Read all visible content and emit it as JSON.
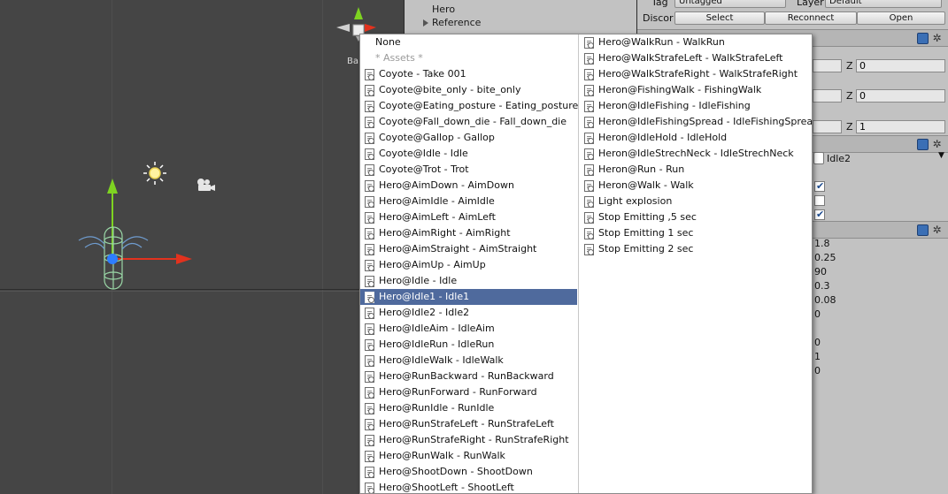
{
  "scene": {
    "gizmo_label": "Ba"
  },
  "hierarchy": {
    "items": [
      {
        "label": "Hero",
        "expandable": false
      },
      {
        "label": "Reference",
        "expandable": true
      }
    ]
  },
  "inspector": {
    "tag_label": "Tag",
    "tag_value": "Untagged",
    "layer_label": "Layer",
    "layer_value": "Default",
    "prefab_label": "Discor",
    "buttons": [
      "Select",
      "Reconnect",
      "Open"
    ],
    "transform": {
      "z_label": "Z",
      "position_z": "0",
      "rotation_z": "0",
      "scale_z": "1"
    },
    "animation_clip": "Idle2",
    "checkboxes": [
      true,
      false,
      true
    ],
    "values": [
      "1.8",
      "0.25",
      "90",
      "0.3",
      "0.08",
      "0",
      "0",
      "1",
      "0"
    ]
  },
  "popup": {
    "left_column": [
      {
        "label": "None",
        "icon": false,
        "style": "normal"
      },
      {
        "label": "* Assets *",
        "icon": false,
        "style": "muted"
      },
      {
        "label": "Coyote - Take 001",
        "icon": true
      },
      {
        "label": "Coyote@bite_only - bite_only",
        "icon": true
      },
      {
        "label": "Coyote@Eating_posture - Eating_posture",
        "icon": true
      },
      {
        "label": "Coyote@Fall_down_die - Fall_down_die",
        "icon": true
      },
      {
        "label": "Coyote@Gallop - Gallop",
        "icon": true
      },
      {
        "label": "Coyote@Idle - Idle",
        "icon": true
      },
      {
        "label": "Coyote@Trot - Trot",
        "icon": true
      },
      {
        "label": "Hero@AimDown - AimDown",
        "icon": true
      },
      {
        "label": "Hero@AimIdle - AimIdle",
        "icon": true
      },
      {
        "label": "Hero@AimLeft - AimLeft",
        "icon": true
      },
      {
        "label": "Hero@AimRight - AimRight",
        "icon": true
      },
      {
        "label": "Hero@AimStraight - AimStraight",
        "icon": true
      },
      {
        "label": "Hero@AimUp - AimUp",
        "icon": true
      },
      {
        "label": "Hero@Idle - Idle",
        "icon": true
      },
      {
        "label": "Hero@Idle1 - Idle1",
        "icon": true,
        "style": "selected"
      },
      {
        "label": "Hero@Idle2 - Idle2",
        "icon": true
      },
      {
        "label": "Hero@IdleAim - IdleAim",
        "icon": true
      },
      {
        "label": "Hero@IdleRun - IdleRun",
        "icon": true
      },
      {
        "label": "Hero@IdleWalk - IdleWalk",
        "icon": true
      },
      {
        "label": "Hero@RunBackward - RunBackward",
        "icon": true
      },
      {
        "label": "Hero@RunForward - RunForward",
        "icon": true
      },
      {
        "label": "Hero@RunIdle - RunIdle",
        "icon": true
      },
      {
        "label": "Hero@RunStrafeLeft - RunStrafeLeft",
        "icon": true
      },
      {
        "label": "Hero@RunStrafeRight - RunStrafeRight",
        "icon": true
      },
      {
        "label": "Hero@RunWalk - RunWalk",
        "icon": true
      },
      {
        "label": "Hero@ShootDown - ShootDown",
        "icon": true
      },
      {
        "label": "Hero@ShootLeft - ShootLeft",
        "icon": true
      }
    ],
    "right_column": [
      {
        "label": "Hero@WalkRun - WalkRun",
        "icon": true
      },
      {
        "label": "Hero@WalkStrafeLeft - WalkStrafeLeft",
        "icon": true
      },
      {
        "label": "Hero@WalkStrafeRight - WalkStrafeRight",
        "icon": true
      },
      {
        "label": "Heron@FishingWalk - FishingWalk",
        "icon": true
      },
      {
        "label": "Heron@IdleFishing - IdleFishing",
        "icon": true
      },
      {
        "label": "Heron@IdleFishingSpread - IdleFishingSpread",
        "icon": true
      },
      {
        "label": "Heron@IdleHold - IdleHold",
        "icon": true
      },
      {
        "label": "Heron@IdleStrechNeck - IdleStrechNeck",
        "icon": true
      },
      {
        "label": "Heron@Run - Run",
        "icon": true
      },
      {
        "label": "Heron@Walk - Walk",
        "icon": true
      },
      {
        "label": "Light explosion",
        "icon": true
      },
      {
        "label": "Stop Emitting ,5 sec",
        "icon": true
      },
      {
        "label": "Stop Emitting 1 sec",
        "icon": true
      },
      {
        "label": "Stop Emitting 2 sec",
        "icon": true
      }
    ]
  },
  "colors": {
    "selection": "#4f6a9d",
    "scene_bg": "#454545",
    "panel_bg": "#c2c2c2",
    "axis_y": "#7ed321",
    "axis_x": "#e2321e",
    "character": "#9ad7a6"
  }
}
